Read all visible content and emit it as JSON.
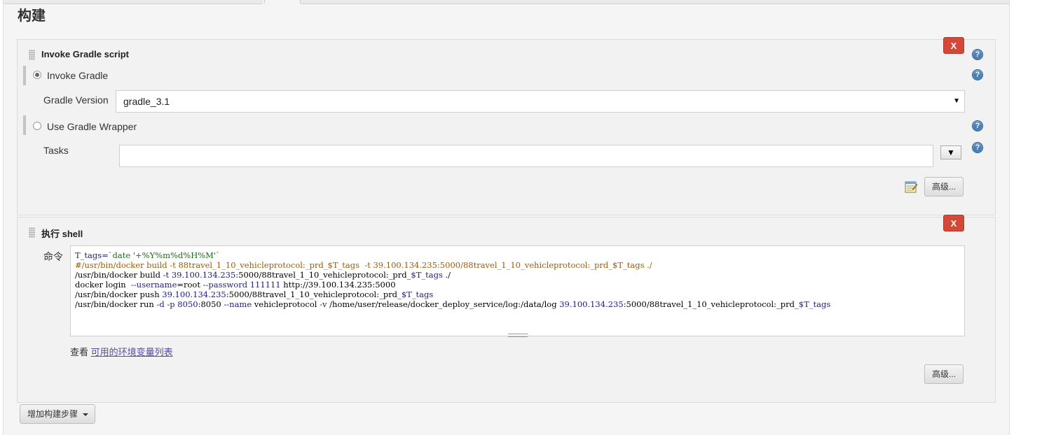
{
  "section": {
    "title": "构建"
  },
  "gradle_step": {
    "title": "Invoke Gradle script",
    "delete_label": "X",
    "invoke_gradle_label": "Invoke Gradle",
    "gradle_version_label": "Gradle Version",
    "gradle_version_value": "gradle_3.1",
    "use_wrapper_label": "Use Gradle Wrapper",
    "tasks_label": "Tasks",
    "tasks_value": "",
    "tasks_dropdown_glyph": "▼",
    "advanced_label": "高级..."
  },
  "shell_step": {
    "title": "执行 shell",
    "delete_label": "X",
    "command_label": "命令",
    "command_lines": [
      [
        [
          "c-var",
          "T_tags="
        ],
        [
          "c-str",
          "`date '+%Y%m%d%H%M'`"
        ]
      ],
      [
        [
          "c-comment",
          "#/usr/bin/docker build -t 88travel_1_10_vehicleprotocol:_prd_$T_tags  -t 39.100.134.235:5000/88travel_1_10_vehicleprotocol:_prd_$T_tags ./"
        ]
      ],
      [
        [
          "c-default",
          "/usr/bin/docker build "
        ],
        [
          "c-var",
          "-t "
        ],
        [
          "c-num",
          "39.100.134.235"
        ],
        [
          "c-default",
          ":5000/88travel_1_10_vehicleprotocol:_prd_"
        ],
        [
          "c-var",
          "$T_tags"
        ],
        [
          "c-default",
          " ./"
        ]
      ],
      [
        [
          "c-default",
          "docker login  "
        ],
        [
          "c-var",
          "--username"
        ],
        [
          "c-default",
          "=root "
        ],
        [
          "c-var",
          "--password"
        ],
        [
          "c-num",
          " 111111"
        ],
        [
          "c-default",
          " http://39.100.134.235:5000"
        ]
      ],
      [
        [
          "c-default",
          "/usr/bin/docker push "
        ],
        [
          "c-num",
          "39.100.134.235"
        ],
        [
          "c-default",
          ":5000/88travel_1_10_vehicleprotocol:_prd_"
        ],
        [
          "c-var",
          "$T_tags"
        ]
      ],
      [
        [
          "c-default",
          "/usr/bin/docker run "
        ],
        [
          "c-var",
          "-d -p"
        ],
        [
          "c-num",
          " 8050"
        ],
        [
          "c-default",
          ":8050 "
        ],
        [
          "c-var",
          "--name"
        ],
        [
          "c-default",
          " vehicleprotocol "
        ],
        [
          "c-var",
          "-v"
        ],
        [
          "c-default",
          " /home/user/release/docker_deploy_service/log:/data/log "
        ],
        [
          "c-num",
          "39.100.134.235"
        ],
        [
          "c-default",
          ":5000/88travel_1_10_vehicleprotocol:_prd_"
        ],
        [
          "c-var",
          "$T_tags"
        ]
      ]
    ],
    "see_prefix": "查看 ",
    "env_link_label": "可用的环境变量列表",
    "advanced_label": "高级..."
  },
  "add_step_label": "增加构建步骤",
  "help_glyph": "?",
  "colors": {
    "delete": "#d24939",
    "help": "#4a7fb5",
    "link": "#5b4b9f"
  },
  "icons": [
    "drag-handle-icon",
    "help-icon",
    "notepad-icon",
    "caret-down-icon",
    "radio-icon"
  ]
}
